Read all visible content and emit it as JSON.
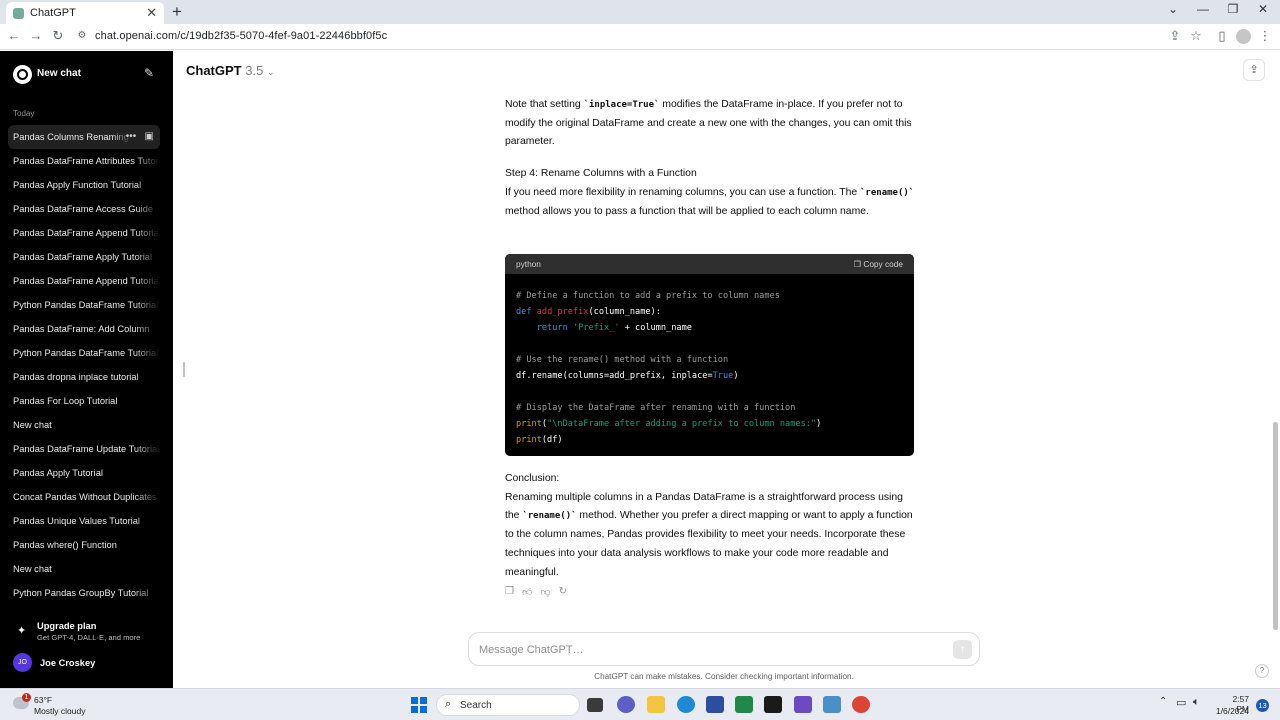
{
  "browser": {
    "tab_title": "ChatGPT",
    "tab_close": "✕",
    "new_tab": "+",
    "url": "chat.openai.com/c/19db2f35-5070-4fef-9a01-22446bbf0f5c"
  },
  "sidebar": {
    "new_chat": "New chat",
    "section_label": "Today",
    "items": [
      {
        "label": "Pandas Columns Renaming"
      },
      {
        "label": "Pandas DataFrame Attributes Tutorial"
      },
      {
        "label": "Pandas Apply Function Tutorial"
      },
      {
        "label": "Pandas DataFrame Access Guide"
      },
      {
        "label": "Pandas DataFrame Append Tutorial"
      },
      {
        "label": "Pandas DataFrame Apply Tutorial"
      },
      {
        "label": "Pandas DataFrame Append Tutorial"
      },
      {
        "label": "Python Pandas DataFrame Tutorial"
      },
      {
        "label": "Pandas DataFrame: Add Column"
      },
      {
        "label": "Python Pandas DataFrame Tutorial"
      },
      {
        "label": "Pandas dropna inplace tutorial"
      },
      {
        "label": "Pandas For Loop Tutorial"
      },
      {
        "label": "New chat"
      },
      {
        "label": "Pandas DataFrame Update Tutorial"
      },
      {
        "label": "Pandas Apply Tutorial"
      },
      {
        "label": "Concat Pandas Without Duplicates"
      },
      {
        "label": "Pandas Unique Values Tutorial"
      },
      {
        "label": "Pandas where() Function"
      },
      {
        "label": "New chat"
      },
      {
        "label": "Python Pandas GroupBy Tutorial"
      }
    ],
    "upgrade_title": "Upgrade plan",
    "upgrade_subtitle": "Get GPT-4, DALL·E, and more",
    "user_initials": "JO",
    "user_name": "Joe Croskey"
  },
  "header": {
    "model_name": "ChatGPT",
    "model_version": "3.5"
  },
  "message": {
    "para1_a": "Note that setting ",
    "para1_code": "`inplace=True`",
    "para1_b": " modifies the DataFrame in-place. If you prefer not to modify the original DataFrame and create a new one with the changes, you can omit this parameter.",
    "step4_title": "Step 4: Rename Columns with a Function",
    "step4_a": "If you need more flexibility in renaming columns, you can use a function. The ",
    "step4_code": "`rename()`",
    "step4_b": " method allows you to pass a function that will be applied to each column name.",
    "code_lang": "python",
    "copy_label": "Copy code",
    "code": {
      "l1": "# Define a function to add a prefix to column names",
      "l2_kw": "def",
      "l2_fn": "add_prefix",
      "l2_rest": "(column_name):",
      "l3_indent": "    ",
      "l3_kw": "return",
      "l3_str": "'Prefix_'",
      "l3_rest": " + column_name",
      "l5": "# Use the rename() method with a function",
      "l6_a": "df.rename(columns=add_prefix, inplace=",
      "l6_val": "True",
      "l6_b": ")",
      "l8": "# Display the DataFrame after renaming with a function",
      "l9_fn": "print",
      "l9_a": "(",
      "l9_str": "\"\\nDataFrame after adding a prefix to column names:\"",
      "l9_b": ")",
      "l10_fn": "print",
      "l10_rest": "(df)"
    },
    "conclusion_title": "Conclusion:",
    "conclusion_a": "Renaming multiple columns in a Pandas DataFrame is a straightforward process using the ",
    "conclusion_code": "`rename()`",
    "conclusion_b": " method. Whether you prefer a direct mapping or want to apply a function to the column names, Pandas provides flexibility to meet your needs. Incorporate these techniques into your data analysis workflows to make your code more readable and meaningful."
  },
  "composer": {
    "placeholder": "Message ChatGPT…",
    "disclaimer": "ChatGPT can make mistakes. Consider checking important information."
  },
  "taskbar": {
    "weather_badge": "1",
    "temperature": "63°F",
    "weather": "Mostly cloudy",
    "search_label": "Search",
    "time": "2:57 PM",
    "date": "1/6/2024",
    "notifications": "13"
  },
  "colors": {
    "sidebar_bg": "#000000",
    "code_keyword": "#2e95d3",
    "code_function": "#f22c3d",
    "code_string": "#00a67d",
    "code_builtin": "#e9950c"
  }
}
